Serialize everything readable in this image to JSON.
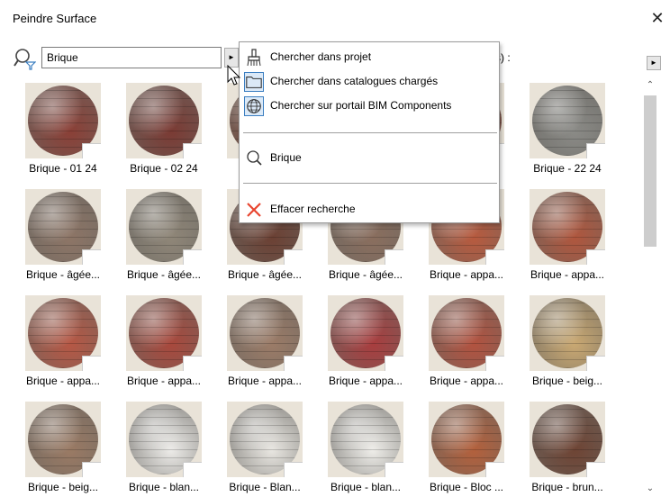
{
  "window": {
    "title": "Peindre Surface",
    "close_glyph": "✕"
  },
  "search": {
    "value": "Brique",
    "options_arrow": "►",
    "side_arrow": "►"
  },
  "partial_label": "s) :",
  "menu": {
    "items": [
      {
        "label": "Chercher dans projet",
        "icon": "paintbrush-icon"
      },
      {
        "label": "Chercher dans catalogues chargés",
        "icon": "folder-icon"
      },
      {
        "label": "Chercher sur portail BIM Components",
        "icon": "globe-icon"
      },
      {
        "label": "Brique",
        "icon": "search-icon"
      },
      {
        "label": "Effacer recherche",
        "icon": "clear-x-icon"
      }
    ]
  },
  "scrollbar": {
    "up": "⌃",
    "down": "⌄"
  },
  "tiles": [
    {
      "label": "Brique - 01 24",
      "color": "#8a3f36"
    },
    {
      "label": "Brique - 02 24",
      "color": "#7a3a33"
    },
    {
      "label": "Bri",
      "color": "#7e4a3b"
    },
    {
      "label": "",
      "color": "#8a5a4a"
    },
    {
      "label": "24",
      "color": "#8c4a3c"
    },
    {
      "label": "Brique - 22 24",
      "color": "#8a8a86"
    },
    {
      "label": "Brique - âgée...",
      "color": "#8d7566"
    },
    {
      "label": "Brique - âgée...",
      "color": "#8f8678"
    },
    {
      "label": "Brique - âgée...",
      "color": "#6b4033"
    },
    {
      "label": "Brique - âgée...",
      "color": "#8a6e5e"
    },
    {
      "label": "Brique - appa...",
      "color": "#b85a3e"
    },
    {
      "label": "Brique - appa...",
      "color": "#b0563d"
    },
    {
      "label": "Brique - appa...",
      "color": "#b65744"
    },
    {
      "label": "Brique - appa...",
      "color": "#a8483c"
    },
    {
      "label": "Brique - appa...",
      "color": "#9b7b67"
    },
    {
      "label": "Brique - appa...",
      "color": "#a83d3e"
    },
    {
      "label": "Brique - appa...",
      "color": "#b2523f"
    },
    {
      "label": "Brique - beig...",
      "color": "#c9a872"
    },
    {
      "label": "Brique - beig...",
      "color": "#9a7a64"
    },
    {
      "label": "Brique - blan...",
      "color": "#ecebe8"
    },
    {
      "label": "Brique - Blan...",
      "color": "#e8e6e1"
    },
    {
      "label": "Brique - blan...",
      "color": "#eeede9"
    },
    {
      "label": "Brique - Bloc ...",
      "color": "#b3603c"
    },
    {
      "label": "Brique - brun...",
      "color": "#6e4434"
    }
  ]
}
